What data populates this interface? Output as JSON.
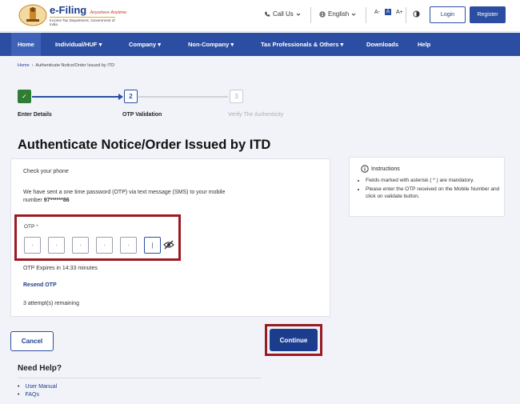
{
  "header": {
    "brand_name": "e-Filing",
    "brand_tagline": "Anywhere Anytime",
    "brand_dept": "Income Tax Department, Government of India",
    "call_us": "Call Us",
    "language": "English",
    "font_small": "A-",
    "font_normal": "A",
    "font_large": "A+",
    "login_label": "Login",
    "register_label": "Register"
  },
  "nav": {
    "items": [
      "Home",
      "Individual/HUF",
      "Company",
      "Non-Company",
      "Tax Professionals & Others",
      "Downloads",
      "Help"
    ]
  },
  "breadcrumb": {
    "home": "Home",
    "current": "Authenticate Notice/Order Issued by ITD"
  },
  "stepper": {
    "steps": [
      {
        "number": "✓",
        "label": "Enter Details",
        "state": "done"
      },
      {
        "number": "2",
        "label": "OTP Validation",
        "state": "active"
      },
      {
        "number": "3",
        "label": "Verify The Authenticity",
        "state": "pending"
      }
    ]
  },
  "page_title": "Authenticate Notice/Order Issued by ITD",
  "otp_card": {
    "check_phone": "Check your phone",
    "message_prefix": "We have sent a one time password (OTP) via text message (SMS) to your mobile number ",
    "mobile_masked": "97******86",
    "otp_label": "OTP",
    "required_mark": "*",
    "otp_digits": [
      "·",
      "·",
      "·",
      "·",
      "·",
      "|"
    ],
    "expires_text": "OTP Expires in 14:33 minutes",
    "resend_label": "Resend OTP",
    "attempts_text": "3 attempt(s) remaining"
  },
  "instructions": {
    "title": "Instructions",
    "items": [
      "Fields marked with asterisk ( * ) are mandatory.",
      "Please enter the OTP received on the Mobile Number and click on validate button."
    ]
  },
  "actions": {
    "cancel_label": "Cancel",
    "continue_label": "Continue"
  },
  "help": {
    "title": "Need Help?",
    "links": [
      "User Manual",
      "FAQs"
    ]
  },
  "colors": {
    "primary": "#2b4ea2",
    "success": "#2e7d32",
    "highlight_border": "#9b1b25"
  }
}
